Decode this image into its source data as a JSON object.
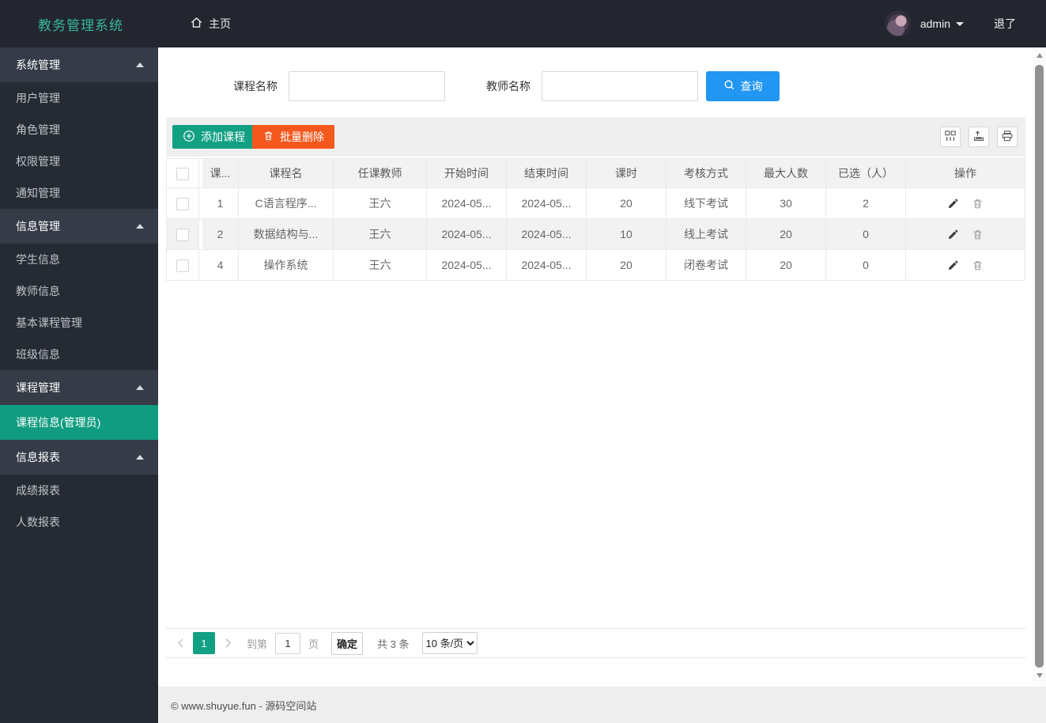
{
  "navbar": {
    "brand": "教务管理系统",
    "home_label": "主页",
    "username": "admin",
    "logout_label": "退了"
  },
  "sidebar": {
    "groups": [
      {
        "label": "系统管理",
        "items": [
          {
            "label": "用户管理"
          },
          {
            "label": "角色管理"
          },
          {
            "label": "权限管理"
          },
          {
            "label": "通知管理"
          }
        ]
      },
      {
        "label": "信息管理",
        "items": [
          {
            "label": "学生信息"
          },
          {
            "label": "教师信息"
          },
          {
            "label": "基本课程管理"
          },
          {
            "label": "班级信息"
          }
        ]
      },
      {
        "label": "课程管理",
        "items": [
          {
            "label": "课程信息(管理员)",
            "active": true
          }
        ]
      },
      {
        "label": "信息报表",
        "items": [
          {
            "label": "成绩报表"
          },
          {
            "label": "人数报表"
          }
        ]
      }
    ]
  },
  "search": {
    "course_label": "课程名称",
    "course_value": "",
    "teacher_label": "教师名称",
    "teacher_value": "",
    "submit_label": "查询"
  },
  "toolbar": {
    "add_label": "添加课程",
    "batch_delete_label": "批量删除"
  },
  "table": {
    "headers": {
      "id": "课...",
      "name": "课程名",
      "teacher": "任课教师",
      "start": "开始时间",
      "end": "结束时间",
      "hours": "课时",
      "exam": "考核方式",
      "max": "最大人数",
      "chosen": "已选（人）",
      "ops": "操作"
    },
    "rows": [
      {
        "id": "1",
        "name": "C语言程序...",
        "teacher": "王六",
        "start": "2024-05...",
        "end": "2024-05...",
        "hours": "20",
        "exam": "线下考试",
        "max": "30",
        "chosen": "2"
      },
      {
        "id": "2",
        "name": "数据结构与...",
        "teacher": "王六",
        "start": "2024-05...",
        "end": "2024-05...",
        "hours": "10",
        "exam": "线上考试",
        "max": "20",
        "chosen": "0"
      },
      {
        "id": "4",
        "name": "操作系统",
        "teacher": "王六",
        "start": "2024-05...",
        "end": "2024-05...",
        "hours": "20",
        "exam": "闭卷考试",
        "max": "20",
        "chosen": "0"
      }
    ]
  },
  "pagination": {
    "current_page": "1",
    "goto_prefix": "到第",
    "goto_value": "1",
    "goto_suffix": "页",
    "confirm_label": "确定",
    "total_label": "共 3 条",
    "page_size_label": "10 条/页"
  },
  "footer": {
    "copyright": "© www.shuyue.fun - 源码空间站"
  },
  "colors": {
    "navbar_bg": "#23262e",
    "sidebar_bg": "#262b33",
    "sidebar_group_bg": "#353b47",
    "brand_teal": "#35b89c",
    "accent_teal": "#12a083",
    "active_menu_teal": "#0f9c80",
    "primary_blue": "#2196f3",
    "danger_orange": "#f4581c",
    "table_stripe": "#f2f2f2",
    "footer_bg": "#eeeeee"
  },
  "icons": {
    "home-icon": "⌂",
    "search-icon": "🔍",
    "plus-circle-icon": "⊕",
    "trash-icon": "🗑",
    "edit-icon": "✎",
    "columns-icon": "▦",
    "export-icon": "⇪",
    "print-icon": "⎙",
    "caret-up-icon": "▲",
    "caret-down-icon": "▼",
    "chevron-left-icon": "‹",
    "chevron-right-icon": "›"
  }
}
